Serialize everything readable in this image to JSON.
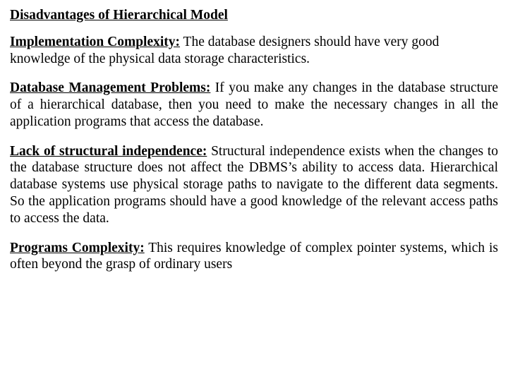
{
  "title": "Disadvantages of Hierarchical Model",
  "sections": [
    {
      "lead": "Implementation Complexity:",
      "body": " The database designers should have very good knowledge of the physical data storage characteristics.",
      "justify": false
    },
    {
      "lead": " Database Management Problems:",
      "body": " If you make any changes in the database structure of a hierarchical database, then you need to make the necessary changes in all the application programs that access the database.",
      "justify": true
    },
    {
      "lead": "Lack of structural independence:",
      "body": " Structural independence exists when the changes to the database structure does not affect the DBMS’s ability to access data. Hierarchical database systems use physical storage paths to navigate to the different data segments. So the application programs should have a good knowledge of the relevant access paths to access the data.",
      "justify": true
    },
    {
      "lead": "Programs Complexity:",
      "body": " This requires knowledge of complex pointer systems, which is often beyond the grasp of ordinary users",
      "justify": true
    }
  ]
}
